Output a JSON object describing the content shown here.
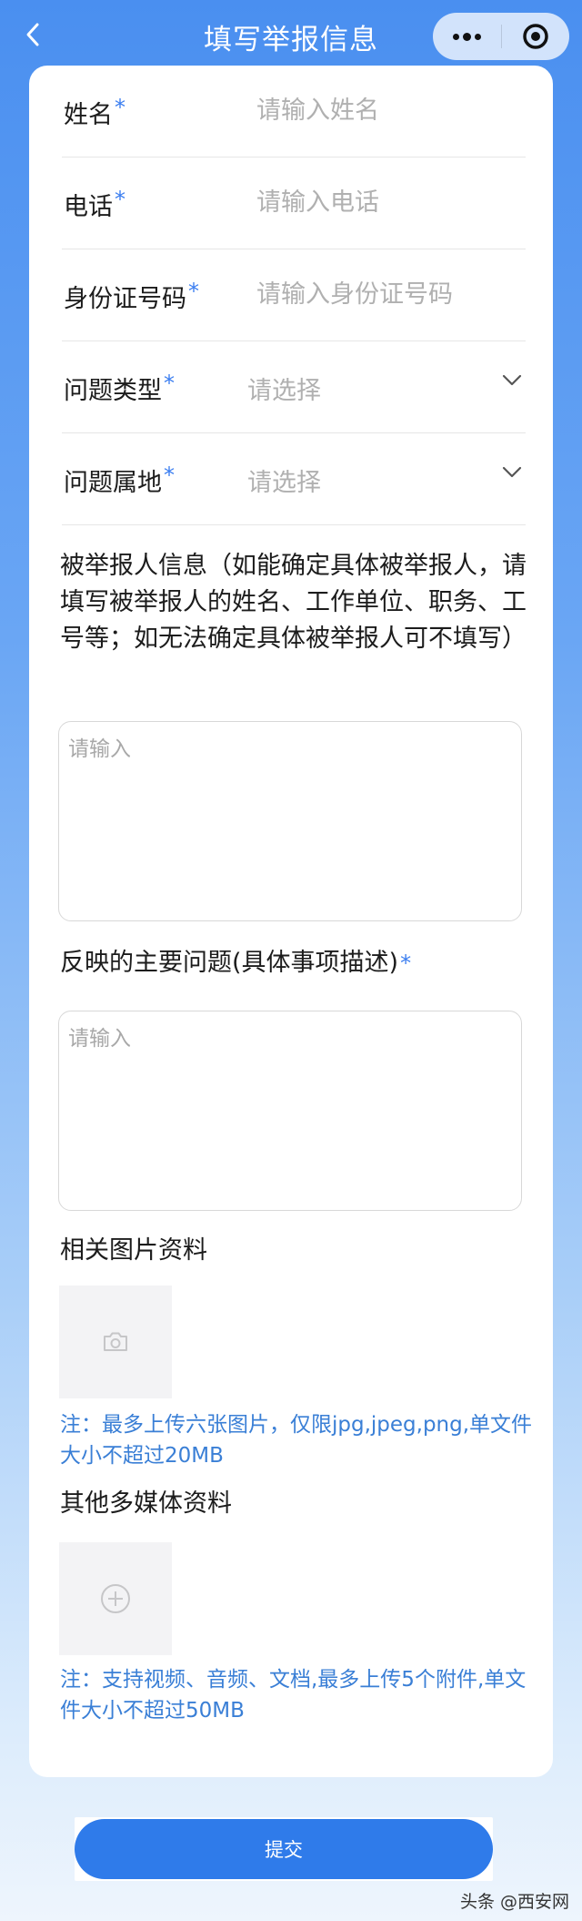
{
  "nav": {
    "title": "填写举报信息"
  },
  "form": {
    "name": {
      "label": "姓名",
      "required": "*",
      "placeholder": "请输入姓名"
    },
    "phone": {
      "label": "电话",
      "required": "*",
      "placeholder": "请输入电话"
    },
    "id_number": {
      "label": "身份证号码",
      "required": "*",
      "placeholder": "请输入身份证号码"
    },
    "issue_type": {
      "label": "问题类型",
      "required": "*",
      "value": "请选择"
    },
    "issue_location": {
      "label": "问题属地",
      "required": "*",
      "value": "请选择"
    },
    "reported_person": {
      "label": "被举报人信息（如能确定具体被举报人，请填写被举报人的姓名、工作单位、职务、工号等；如无法确定具体被举报人可不填写）",
      "placeholder": "请输入"
    },
    "main_issue": {
      "label": "反映的主要问题(具体事项描述)",
      "required": "*",
      "placeholder": "请输入"
    },
    "images": {
      "label": "相关图片资料",
      "note": "注：最多上传六张图片，仅限jpg,jpeg,png,单文件大小不超过20MB"
    },
    "media": {
      "label": "其他多媒体资料",
      "note": "注：支持视频、音频、文档,最多上传5个附件,单文件大小不超过50MB"
    }
  },
  "submit_label": "提交",
  "watermark": "头条 @西安网"
}
